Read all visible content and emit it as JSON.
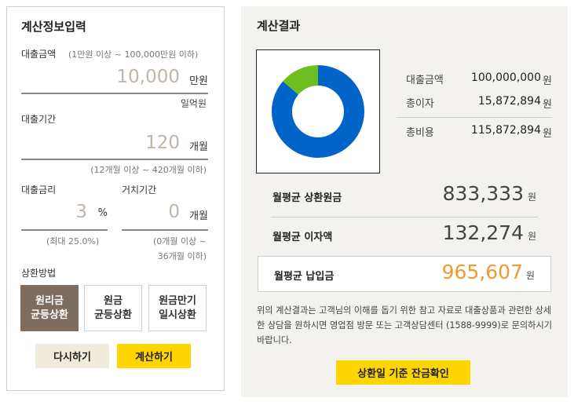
{
  "input": {
    "title": "계산정보입력",
    "loan_amount": {
      "label": "대출금액",
      "hint": "(1만원 이상 ~ 100,000만원 이하)",
      "value": "10,000",
      "unit": "만원",
      "korean_reading": "일억원"
    },
    "loan_period": {
      "label": "대출기간",
      "value": "120",
      "unit": "개월",
      "hint": "(12개월 이상 ~ 420개월 이하)"
    },
    "interest_rate": {
      "label": "대출금리",
      "value": "3",
      "unit": "%",
      "hint": "(최대 25.0%)"
    },
    "grace_period": {
      "label": "거치기간",
      "value": "0",
      "unit": "개월",
      "hint_line1": "(0개월 이상 ~",
      "hint_line2": "36개월 이하)"
    },
    "repayment_method": {
      "label": "상환방법",
      "options": [
        {
          "line1": "원리금",
          "line2": "균등상환",
          "selected": true
        },
        {
          "line1": "원금",
          "line2": "균등상환",
          "selected": false
        },
        {
          "line1": "원금만기",
          "line2": "일시상환",
          "selected": false
        }
      ]
    },
    "reset_button": "다시하기",
    "calculate_button": "계산하기"
  },
  "result": {
    "title": "계산결과",
    "summary": {
      "loan_amount_label": "대출금액",
      "loan_amount_value": "100,000,000",
      "total_interest_label": "총이자",
      "total_interest_value": "15,872,894",
      "total_cost_label": "총비용",
      "total_cost_value": "115,872,894",
      "currency": "원"
    },
    "monthly": {
      "principal_label": "월평균 상환원금",
      "principal_value": "833,333",
      "interest_label": "월평균 이자액",
      "interest_value": "132,274",
      "payment_label": "월평균 납입금",
      "payment_value": "965,607",
      "currency": "원"
    },
    "notice": "위의 계산결과는 고객님의 이해를 돕기 위한 참고 자료로 대출상품과 관련한 상세한 상담을 원하시면 영업점 방문 또는 고객상담센터 (1588-9999)로 문의하시기 바랍니다.",
    "balance_check_button": "상환일 기준 잔금확인"
  },
  "chart_data": {
    "type": "pie",
    "categories": [
      "대출금액",
      "총이자"
    ],
    "values": [
      100000000,
      15872894
    ],
    "colors": [
      "#0064c8",
      "#6cbf1f"
    ]
  },
  "colors": {
    "accent_yellow": "#ffd500",
    "selected_brown": "#7d6d60",
    "reset_beige": "#f1ebde",
    "highlight_orange": "#f29a2e",
    "result_bg": "#f3f2ef"
  }
}
